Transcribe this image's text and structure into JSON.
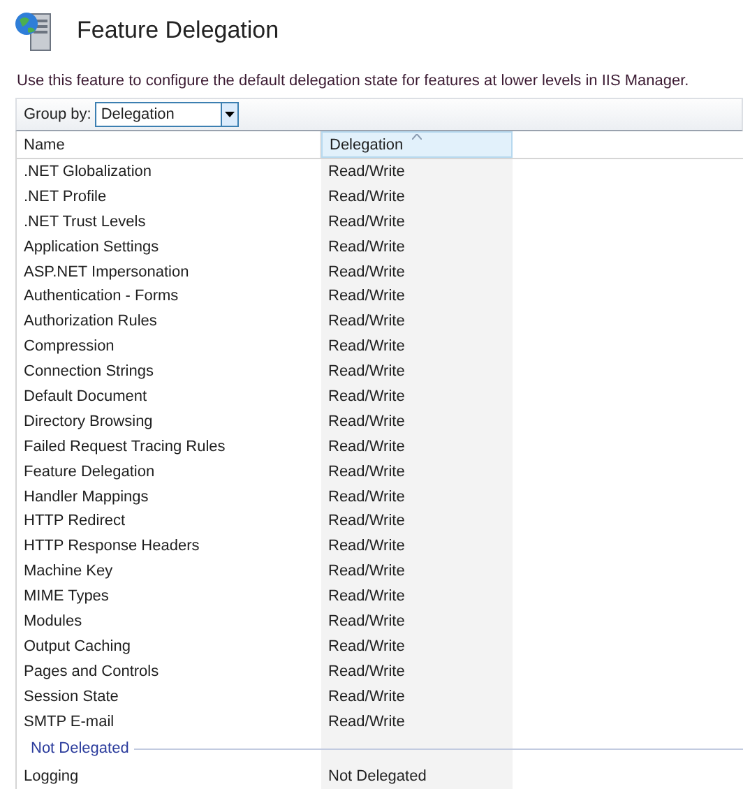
{
  "header": {
    "title": "Feature Delegation",
    "description": "Use this feature to configure the default delegation state for features at lower levels in IIS Manager."
  },
  "toolbar": {
    "group_by_label": "Group by:",
    "group_by_value": "Delegation"
  },
  "table": {
    "columns": [
      {
        "label": "Name",
        "sorted": false
      },
      {
        "label": "Delegation",
        "sorted": true
      }
    ],
    "groups": [
      {
        "rows": [
          {
            "name": ".NET Globalization",
            "delegation": "Read/Write"
          },
          {
            "name": ".NET Profile",
            "delegation": "Read/Write"
          },
          {
            "name": ".NET Trust Levels",
            "delegation": "Read/Write"
          },
          {
            "name": "Application Settings",
            "delegation": "Read/Write"
          },
          {
            "name": "ASP.NET Impersonation",
            "delegation": "Read/Write"
          },
          {
            "name": "Authentication - Forms",
            "delegation": "Read/Write"
          },
          {
            "name": "Authorization Rules",
            "delegation": "Read/Write"
          },
          {
            "name": "Compression",
            "delegation": "Read/Write"
          },
          {
            "name": "Connection Strings",
            "delegation": "Read/Write"
          },
          {
            "name": "Default Document",
            "delegation": "Read/Write"
          },
          {
            "name": "Directory Browsing",
            "delegation": "Read/Write"
          },
          {
            "name": "Failed Request Tracing Rules",
            "delegation": "Read/Write"
          },
          {
            "name": "Feature Delegation",
            "delegation": "Read/Write"
          },
          {
            "name": "Handler Mappings",
            "delegation": "Read/Write"
          },
          {
            "name": "HTTP Redirect",
            "delegation": "Read/Write"
          },
          {
            "name": "HTTP Response Headers",
            "delegation": "Read/Write"
          },
          {
            "name": "Machine Key",
            "delegation": "Read/Write"
          },
          {
            "name": "MIME Types",
            "delegation": "Read/Write"
          },
          {
            "name": "Modules",
            "delegation": "Read/Write"
          },
          {
            "name": "Output Caching",
            "delegation": "Read/Write"
          },
          {
            "name": "Pages and Controls",
            "delegation": "Read/Write"
          },
          {
            "name": "Session State",
            "delegation": "Read/Write"
          },
          {
            "name": "SMTP E-mail",
            "delegation": "Read/Write"
          }
        ]
      },
      {
        "title": "Not Delegated",
        "rows": [
          {
            "name": "Logging",
            "delegation": "Not Delegated"
          }
        ]
      }
    ]
  }
}
